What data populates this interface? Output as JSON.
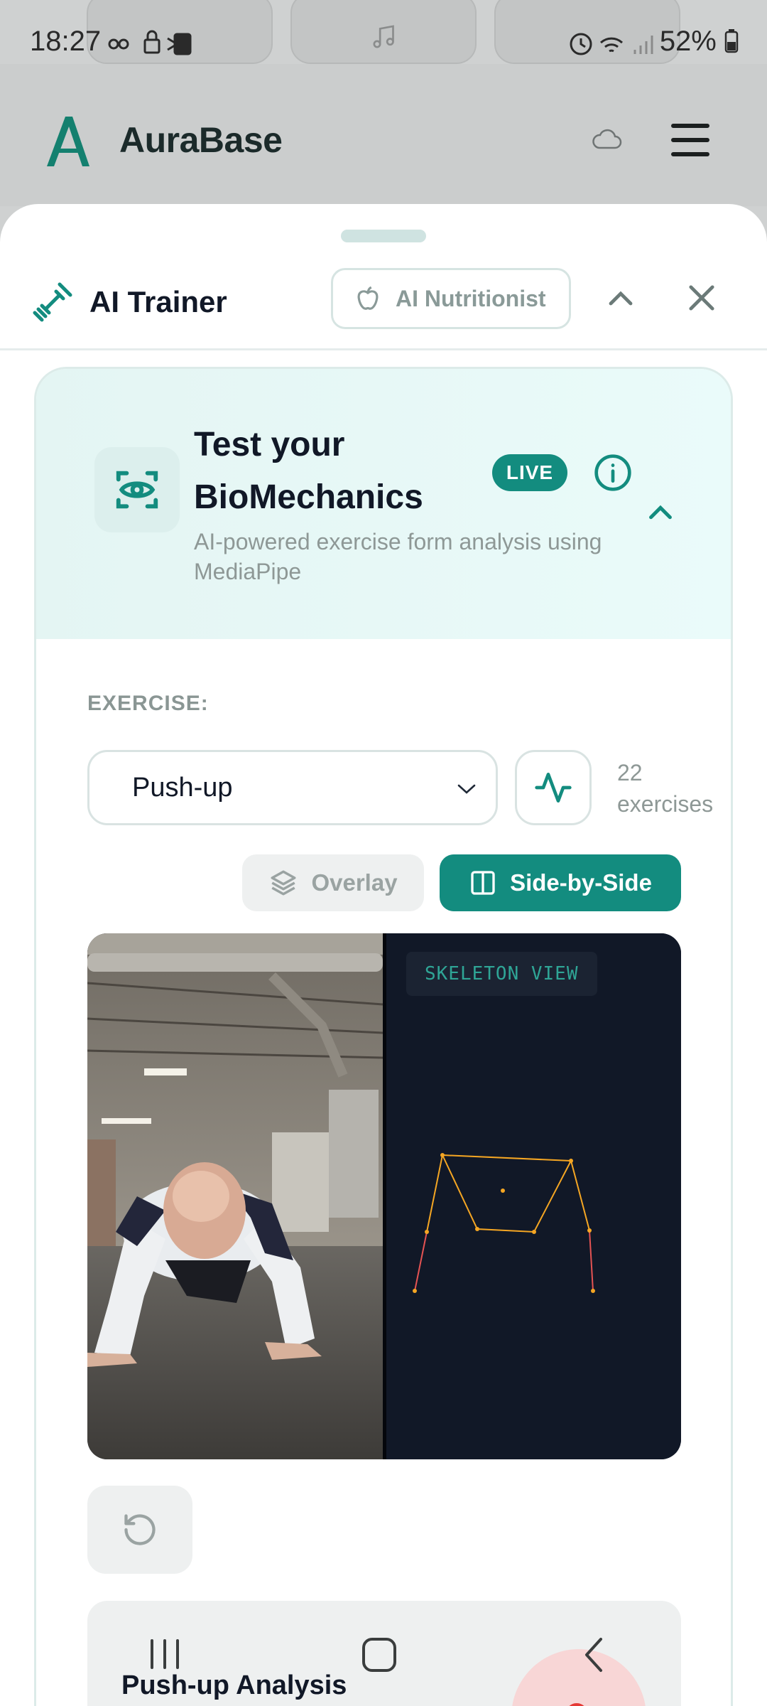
{
  "status_bar": {
    "time": "18:27",
    "battery": "52%"
  },
  "background_app": {
    "brand": "AuraBase"
  },
  "sheet": {
    "title": "AI Trainer",
    "nutritionist_button": "AI Nutritionist"
  },
  "hero": {
    "title": "Test your BioMechanics",
    "badge": "LIVE",
    "subtitle": "AI-powered exercise form analysis using MediaPipe"
  },
  "exercise": {
    "label": "EXERCISE:",
    "selected": "Push-up",
    "count_number": "22",
    "count_unit": "exercises"
  },
  "view_toggle": {
    "overlay_label": "Overlay",
    "side_by_side_label": "Side-by-Side",
    "active": "Side-by-Side"
  },
  "video": {
    "skeleton_label": "SKELETON VIEW"
  },
  "analysis": {
    "title": "Push-up Analysis"
  },
  "colors": {
    "accent": "#138c7f",
    "skeleton_bg": "#111827",
    "skeleton_joint": "#f5a623",
    "record_red": "#e53935"
  }
}
